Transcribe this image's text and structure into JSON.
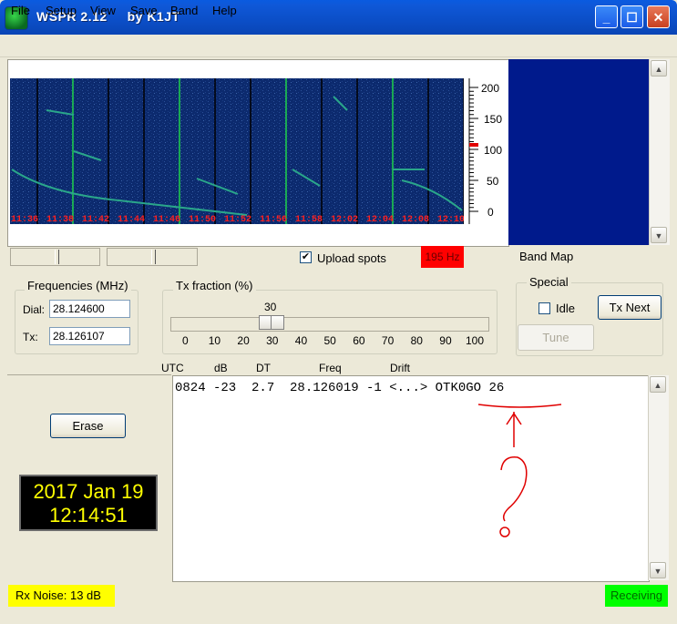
{
  "window": {
    "title": "WSPR 2.12     by K1JT",
    "controls": [
      "minimize",
      "maximize",
      "close"
    ]
  },
  "menu": [
    "File",
    "Setup",
    "View",
    "Save",
    "Band",
    "Help"
  ],
  "waterfall": {
    "time_labels": [
      "11:36",
      "11:38",
      "11:42",
      "11:44",
      "11:46",
      "11:50",
      "11:52",
      "11:56",
      "11:58",
      "12:02",
      "12:04",
      "12:08",
      "12:10"
    ],
    "freq_scale": [
      "200",
      "150",
      "100",
      "50",
      "0"
    ]
  },
  "controls_row": {
    "upload_spots_label": "Upload spots",
    "upload_spots_checked": true,
    "hz_indicator": "195 Hz",
    "band_map_label": "Band Map"
  },
  "frequencies": {
    "legend": "Frequencies (MHz)",
    "dial_label": "Dial:",
    "dial_value": "28.124600",
    "tx_label": "Tx:",
    "tx_value": "28.126107"
  },
  "tx_fraction": {
    "legend": "Tx fraction (%)",
    "value": "30",
    "ticks": [
      "0",
      "10",
      "20",
      "30",
      "40",
      "50",
      "60",
      "70",
      "80",
      "90",
      "100"
    ]
  },
  "special": {
    "legend": "Special",
    "idle_label": "Idle",
    "tx_next_label": "Tx Next",
    "tune_label": "Tune"
  },
  "decode_header": [
    "UTC",
    "dB",
    "DT",
    "Freq",
    "Drift"
  ],
  "decode_lines": [
    "0824 -23  2.7  28.126019 -1 <...> OTK0GO 26"
  ],
  "erase_label": "Erase",
  "clock": {
    "date": "2017 Jan 19",
    "time": "12:14:51"
  },
  "status": {
    "rx_noise": "Rx Noise:  13  dB",
    "receiving": "Receiving"
  },
  "colors": {
    "waterfall_bg": "#0c2a6e",
    "band_map_bg": "#001a8c",
    "hz_box": "#ff0000",
    "rx_noise_bg": "#ffff00",
    "receiving_bg": "#00ff00",
    "clock_text": "#ffff00",
    "annotation": "#e00000"
  }
}
